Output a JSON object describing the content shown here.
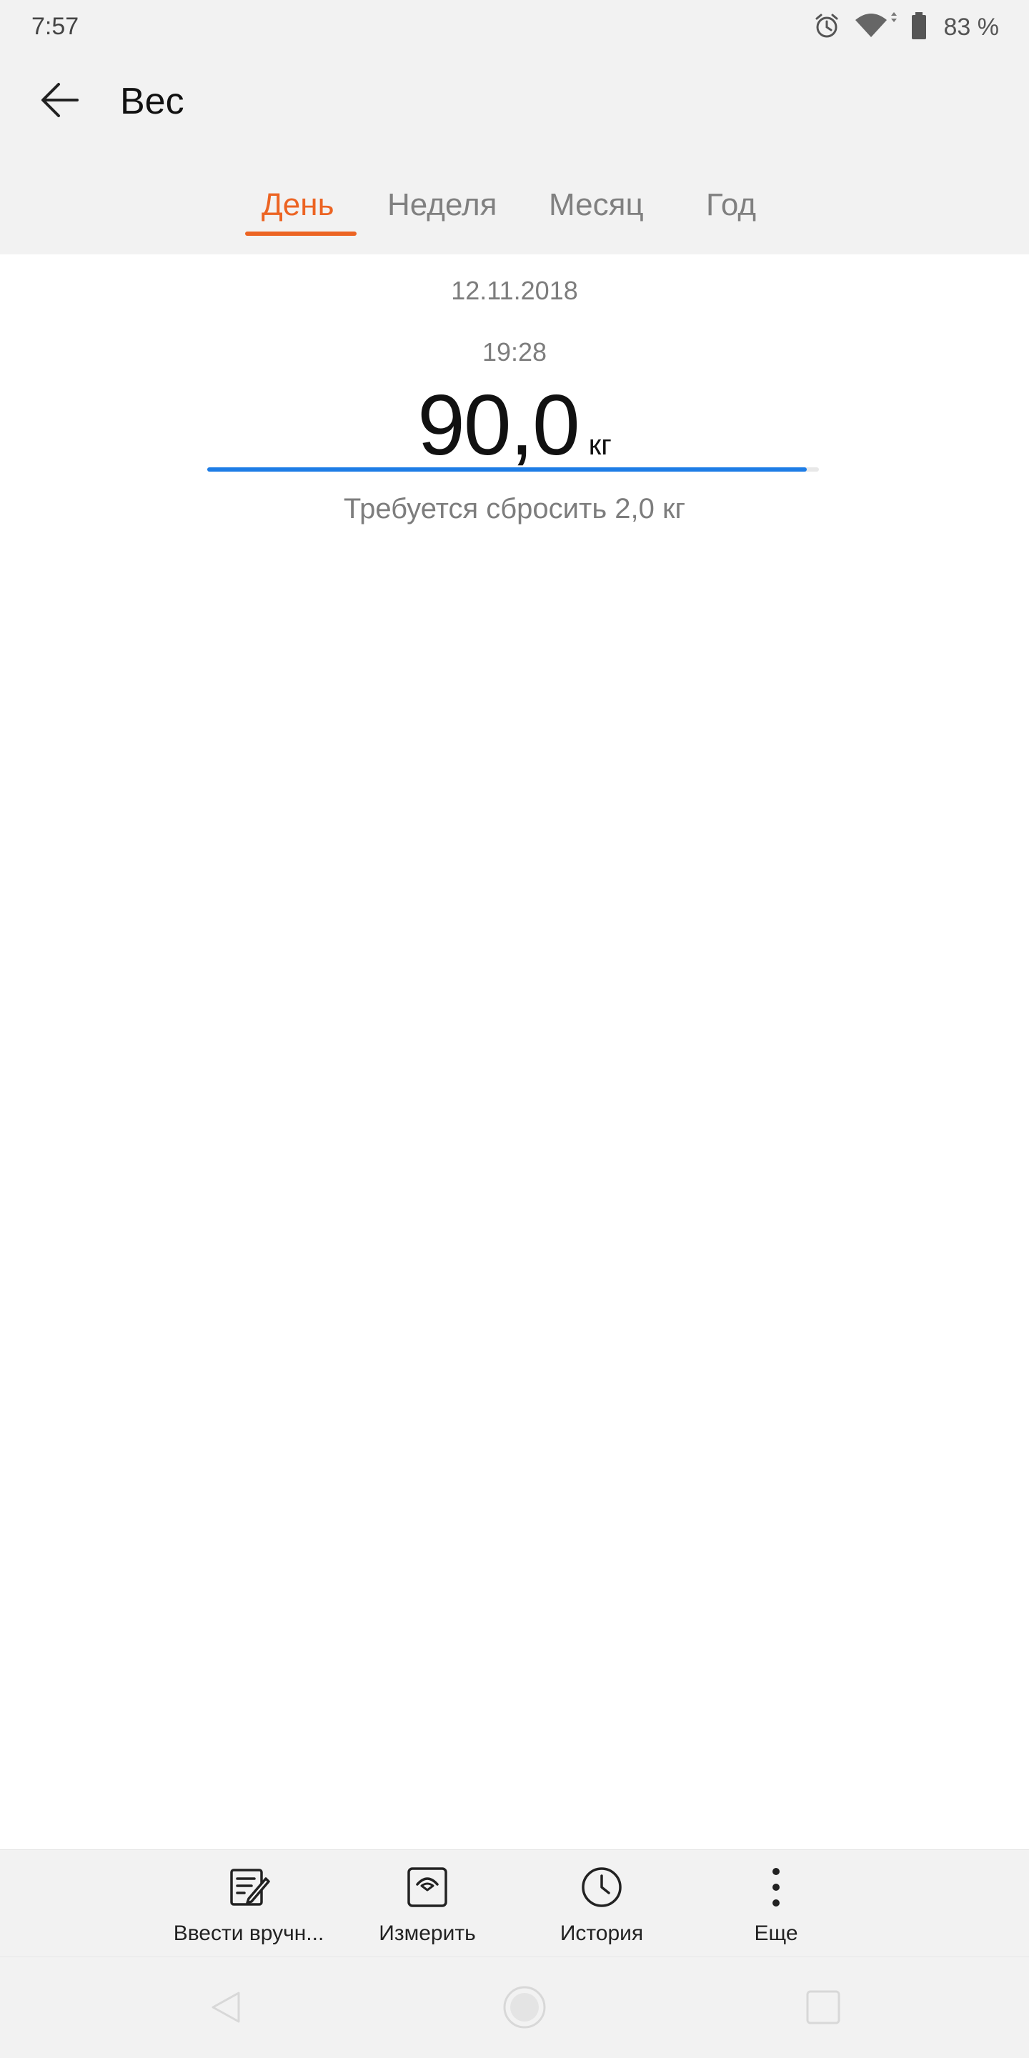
{
  "status_bar": {
    "time": "7:57",
    "battery_text": "83 %",
    "icons": [
      "alarm-icon",
      "wifi-icon",
      "battery-icon"
    ]
  },
  "app_bar": {
    "title": "Вес",
    "back_icon": "arrow-left-icon"
  },
  "tabs": [
    {
      "label": "День",
      "active": true
    },
    {
      "label": "Неделя",
      "active": false
    },
    {
      "label": "Месяц",
      "active": false
    },
    {
      "label": "Год",
      "active": false
    }
  ],
  "measurement": {
    "date": "12.11.2018",
    "time": "19:28",
    "weight": "90,0",
    "unit": "кг",
    "progress_percent": 98,
    "goal_text": "Требуется сбросить 2,0 кг"
  },
  "actions": [
    {
      "label": "Ввести вручн...",
      "icon": "edit-note-icon"
    },
    {
      "label": "Измерить",
      "icon": "scale-icon"
    },
    {
      "label": "История",
      "icon": "clock-icon"
    },
    {
      "label": "Еще",
      "icon": "more-vertical-icon"
    }
  ],
  "colors": {
    "accent": "#ec6423",
    "progress": "#1e7de6",
    "background": "#ffffff",
    "bars": "#f2f2f2"
  }
}
